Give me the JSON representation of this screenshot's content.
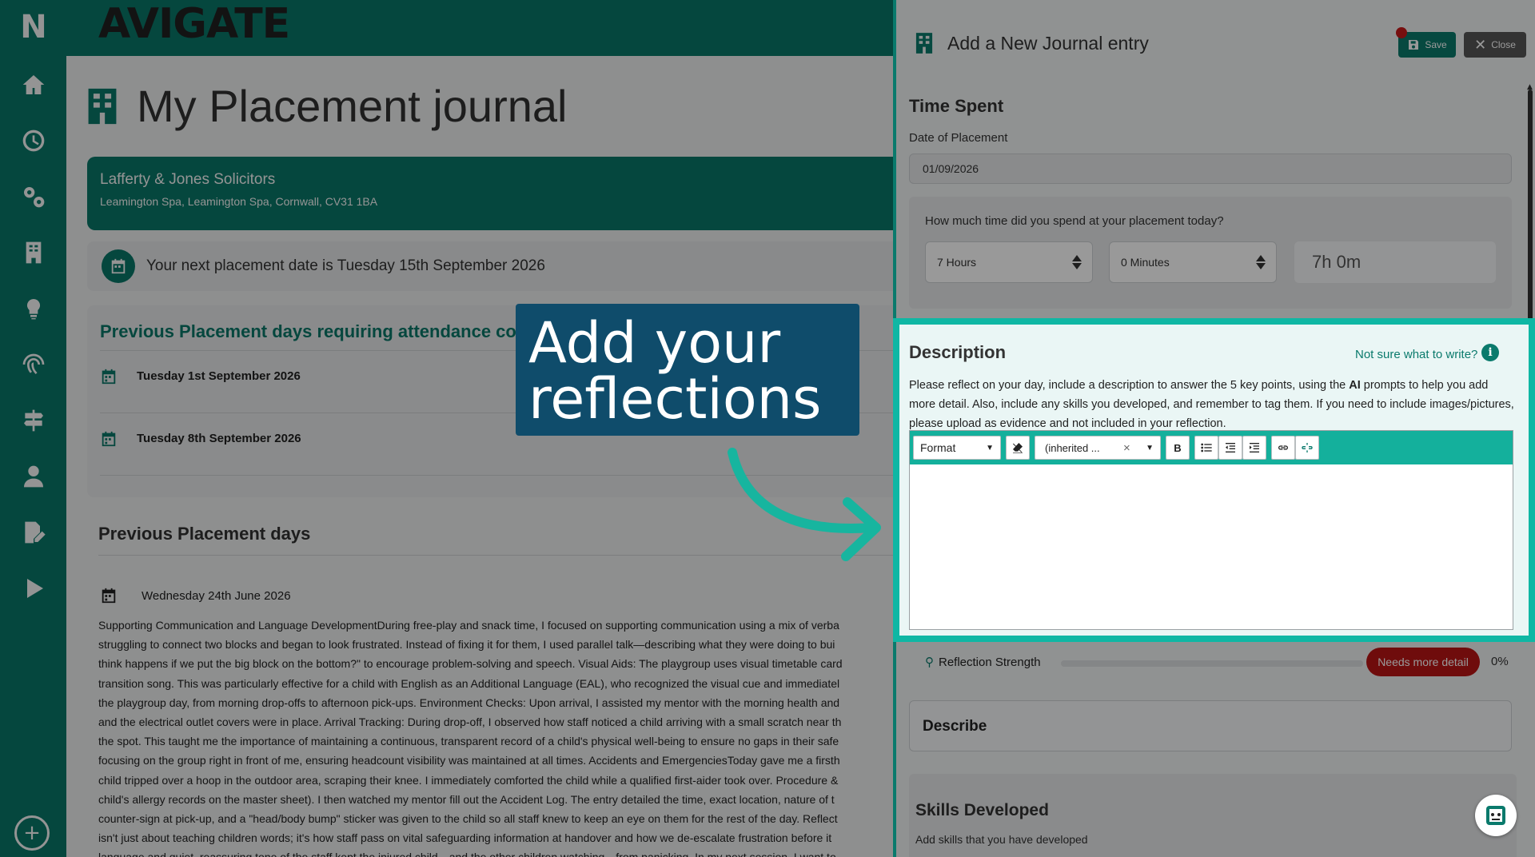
{
  "app": {
    "brand": "AVIGATE",
    "logo_letter": "N"
  },
  "sidebar": {
    "items": [
      {
        "icon": "home-icon"
      },
      {
        "icon": "clock-icon"
      },
      {
        "icon": "gears-icon"
      },
      {
        "icon": "building-icon"
      },
      {
        "icon": "lightbulb-icon"
      },
      {
        "icon": "fingerprint-icon"
      },
      {
        "icon": "signpost-icon"
      },
      {
        "icon": "user-icon"
      },
      {
        "icon": "edit-document-icon"
      },
      {
        "icon": "play-icon"
      }
    ],
    "bottom_icon": "add-circle-icon"
  },
  "page": {
    "title": "My Placement journal",
    "placement": {
      "name": "Lafferty & Jones Solicitors",
      "address": "Leamington Spa, Leamington Spa, Cornwall, CV31 1BA"
    },
    "next_date_text": "Your next placement date is Tuesday 15th September 2026",
    "requiring_title": "Previous Placement days requiring attendance conf",
    "requiring_days": [
      "Tuesday 1st September 2026",
      "Tuesday 8th September 2026"
    ],
    "previous_title": "Previous Placement days",
    "previous_day": "Wednesday 24th June 2026",
    "journal_lines": [
      "Supporting Communication and Language DevelopmentDuring free-play and snack time, I focused on supporting communication using a mix of verba",
      "struggling to connect two blocks and began to look frustrated. Instead of fixing it for them, I used parallel talk—describing what they were doing to bui",
      "think happens if we put the big block on the bottom?\" to encourage problem-solving and speech. Visual Aids: The playgroup uses visual timetable card",
      "transition song. This was particularly effective for a child with English as an Additional Language (EAL), who recognized the visual cue and immediatel",
      "the playgroup day, from morning drop-offs to afternoon pick-ups. Environment Checks: Upon arrival, I assisted my mentor with the morning health and",
      "and the electrical outlet covers were in place. Arrival Tracking: During drop-off, I observed how staff noticed a child arriving with a small scratch near th",
      "the spot. This taught me the importance of maintaining a continuous, transparent record of a child's physical well-being to ensure no gaps in their safe",
      "focusing on the group right in front of me, ensuring headcount visibility was maintained at all times. Accidents and EmergenciesToday gave me a firsth",
      "child tripped over a hoop in the outdoor area, scraping their knee. I immediately comforted the child while a qualified first-aider took over. Procedure &",
      "child's allergy records on the master sheet). I then watched my mentor fill out the Accident Log. The entry detailed the time, exact location, nature of t",
      "counter-sign at pick-up, and a \"head/body bump\" sticker was given to the child so all staff knew to keep an eye on them for the rest of the day. Reflect",
      "isn't just about teaching children words; it's how staff pass on vital safeguarding information at handover and how we de-escalate frustration before it",
      "language and quiet, reassuring tone of the staff kept the injured child—and the other children watching—from panicking. In my next session, I want to"
    ]
  },
  "drawer": {
    "title": "Add a New Journal entry",
    "save_label": "Save",
    "close_label": "Close",
    "time_spent_title": "Time Spent",
    "date_label": "Date of Placement",
    "date_value": "01/09/2026",
    "time_question": "How much time did you spend at your placement today?",
    "hours_value": "7 Hours",
    "minutes_value": "0 Minutes",
    "total_time": "7h 0m",
    "description": {
      "title": "Description",
      "help_link": "Not sure what to write?",
      "instructions_before": "Please reflect on your day, include a description to answer the 5 key points, using the ",
      "instructions_bold": "AI",
      "instructions_after": " prompts to help you add more detail. Also, include any skills you developed, and remember to tag them. If you need to include images/pictures, please upload as evidence and not included in your reflection.",
      "editor": {
        "format_label": "Format",
        "font_label": "(inherited ...",
        "clear_label": "×",
        "bold_label": "B"
      }
    },
    "reflection_label": "Reflection Strength",
    "reflection_badge": "Needs more detail",
    "reflection_percent": "0%",
    "reflection_value": 0,
    "describe_label": "Describe",
    "skills_title": "Skills Developed",
    "skills_sub": "Add skills that you have developed"
  },
  "callout": {
    "text_line1": "Add your",
    "text_line2": "reflections"
  },
  "colors": {
    "brand_teal": "#0a7a6c",
    "highlight_teal": "#0fb7a4",
    "callout_navy": "#0f4c6b",
    "badge_red": "#b91515"
  }
}
